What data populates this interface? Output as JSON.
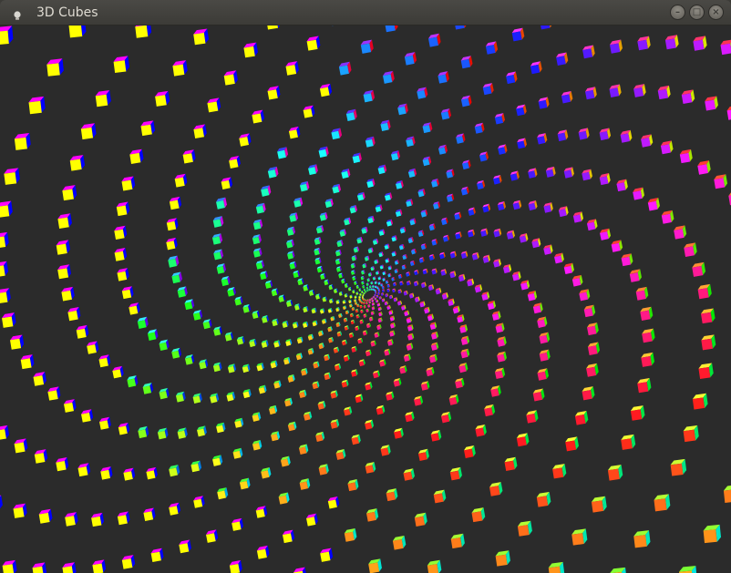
{
  "window": {
    "title": "3D Cubes",
    "icons": {
      "app": "application-icon",
      "minimize": "minimize-icon",
      "maximize": "maximize-icon",
      "close": "close-icon"
    },
    "glyphs": {
      "minimize": "–",
      "maximize": "□",
      "close": "×"
    }
  },
  "colors": {
    "titlebar": "#3c3b37",
    "title_text": "#dfdbd2",
    "canvas_background": "#2b2b2b",
    "cube_top": "#ff00ff",
    "cube_side": "#0000ff",
    "cube_front": "#ffff00"
  }
}
